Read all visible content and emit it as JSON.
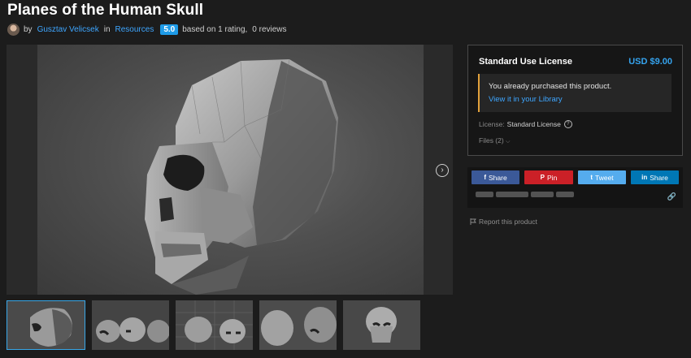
{
  "product": {
    "title": "Planes of the Human Skull",
    "by_label": "by",
    "author": "Gusztav Velicsek",
    "in_label": "in",
    "category": "Resources",
    "rating": "5.0",
    "rating_text": "based on 1 rating,",
    "reviews_text": "0 reviews"
  },
  "license": {
    "title": "Standard Use License",
    "price": "USD $9.00",
    "notice": "You already purchased this product.",
    "library_link": "View it in your Library",
    "license_label": "License:",
    "license_value": "Standard License",
    "files_label": "Files (2)"
  },
  "share": {
    "facebook": "Share",
    "pinterest": "Pin",
    "twitter": "Tweet",
    "linkedin": "Share",
    "colors": {
      "facebook": "#3b5998",
      "pinterest": "#cb2027",
      "twitter": "#55acee",
      "linkedin": "#0077b5"
    }
  },
  "report": "Report this product",
  "icons": [
    "chevron-right-icon",
    "facebook-icon",
    "pinterest-icon",
    "twitter-icon",
    "linkedin-icon",
    "link-icon",
    "flag-icon",
    "help-icon",
    "chevron-down-icon"
  ]
}
